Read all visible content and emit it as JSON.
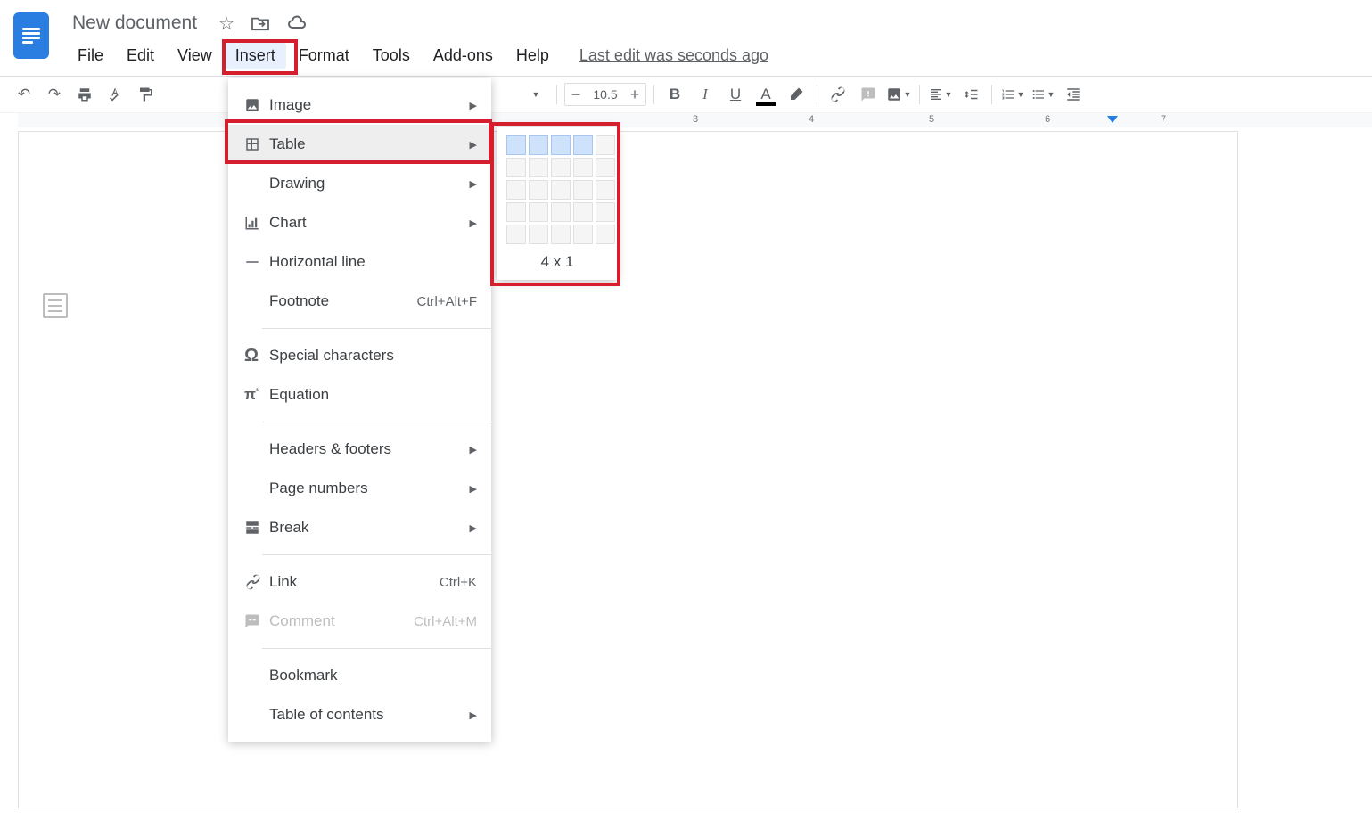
{
  "doc": {
    "title": "New document"
  },
  "menus": [
    "File",
    "Edit",
    "View",
    "Insert",
    "Format",
    "Tools",
    "Add-ons",
    "Help"
  ],
  "active_menu_index": 3,
  "last_edit": "Last edit was seconds ago",
  "toolbar": {
    "font_size": "10.5"
  },
  "insert_menu": {
    "items": [
      {
        "icon": "image-icon",
        "label": "Image",
        "sub": true
      },
      {
        "icon": "table-icon",
        "label": "Table",
        "sub": true,
        "hover": true
      },
      {
        "icon": "drawing-icon",
        "label": "Drawing",
        "sub": true
      },
      {
        "icon": "chart-icon",
        "label": "Chart",
        "sub": true
      },
      {
        "icon": "hr-icon",
        "label": "Horizontal line"
      },
      {
        "icon": "footnote-icon",
        "label": "Footnote",
        "shortcut": "Ctrl+Alt+F",
        "noicon": true
      },
      {
        "sep": true
      },
      {
        "icon": "omega-icon",
        "label": "Special characters"
      },
      {
        "icon": "pi-icon",
        "label": "Equation"
      },
      {
        "sep": true
      },
      {
        "icon": "header-icon",
        "label": "Headers & footers",
        "sub": true,
        "noicon": true
      },
      {
        "icon": "pagenum-icon",
        "label": "Page numbers",
        "sub": true,
        "noicon": true
      },
      {
        "icon": "break-icon",
        "label": "Break",
        "sub": true
      },
      {
        "sep": true
      },
      {
        "icon": "link-icon",
        "label": "Link",
        "shortcut": "Ctrl+K"
      },
      {
        "icon": "comment-icon",
        "label": "Comment",
        "shortcut": "Ctrl+Alt+M",
        "disabled": true
      },
      {
        "sep": true
      },
      {
        "icon": "bookmark-icon",
        "label": "Bookmark",
        "noicon": true
      },
      {
        "icon": "toc-icon",
        "label": "Table of contents",
        "sub": true,
        "noicon": true
      }
    ]
  },
  "table_popup": {
    "selected_cols": 4,
    "selected_rows": 1,
    "label": "4 x 1"
  },
  "ruler": {
    "numbers": [
      3,
      4,
      5,
      6,
      7
    ]
  }
}
